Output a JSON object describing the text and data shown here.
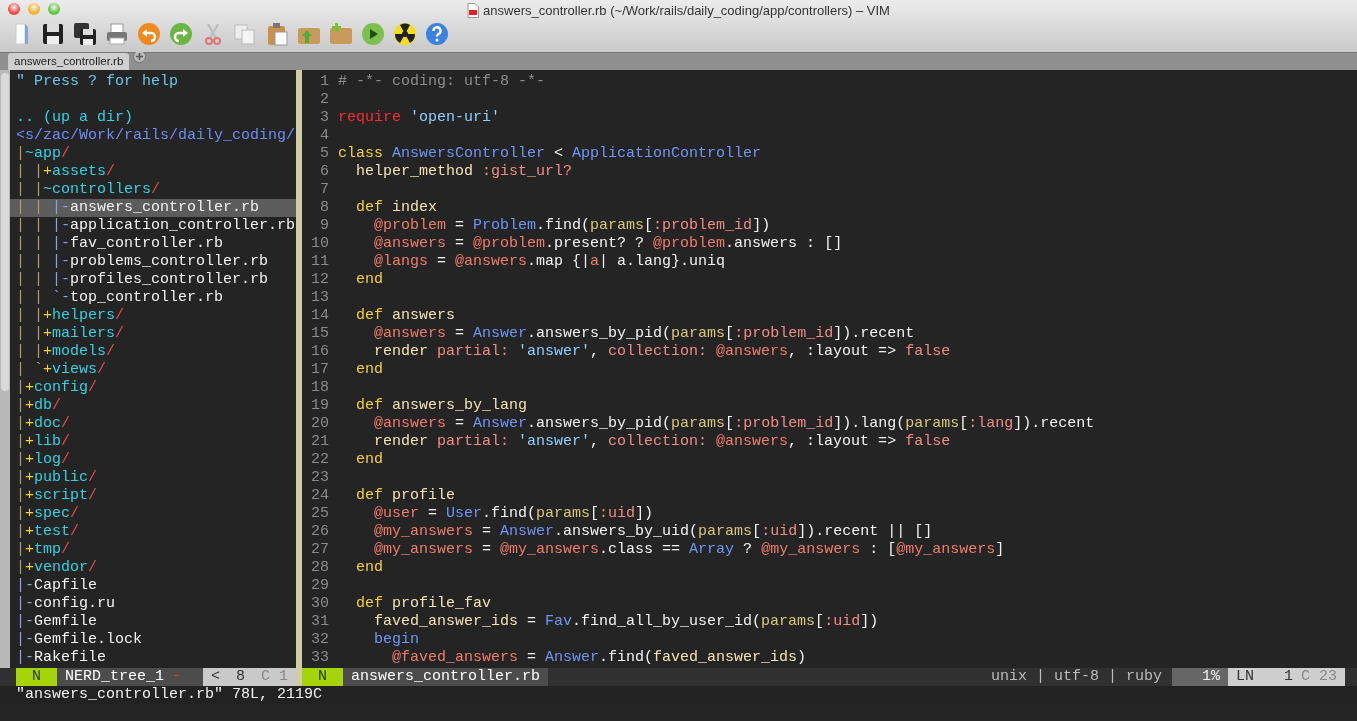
{
  "window": {
    "title": "answers_controller.rb (~/Work/rails/daily_coding/app/controllers) – VIM"
  },
  "tabs": [
    {
      "label": "answers_controller.rb",
      "selected": true
    }
  ],
  "nerd_tree": {
    "help": "\" Press ? for help",
    "up": ".. (up a dir)",
    "root": "<s/zac/Work/rails/daily_coding/",
    "items": [
      {
        "kind": "dir",
        "branch": "|",
        "marker": "~",
        "name": "app",
        "suffix": "/",
        "expanded": true,
        "selected": false,
        "children": [
          {
            "kind": "dir",
            "guides": "| ",
            "branch": "|",
            "marker": "+",
            "name": "assets",
            "suffix": "/",
            "expanded": false,
            "selected": false
          },
          {
            "kind": "dir",
            "guides": "| ",
            "branch": "|",
            "marker": "~",
            "name": "controllers",
            "suffix": "/",
            "expanded": true,
            "selected": false,
            "children": [
              {
                "kind": "file",
                "guides": "| | ",
                "branch": "|",
                "marker": "-",
                "name": "answers_controller.rb",
                "selected": true
              },
              {
                "kind": "file",
                "guides": "| | ",
                "branch": "|",
                "marker": "-",
                "name": "application_controller.rb",
                "selected": false
              },
              {
                "kind": "file",
                "guides": "| | ",
                "branch": "|",
                "marker": "-",
                "name": "fav_controller.rb",
                "selected": false
              },
              {
                "kind": "file",
                "guides": "| | ",
                "branch": "|",
                "marker": "-",
                "name": "problems_controller.rb",
                "selected": false
              },
              {
                "kind": "file",
                "guides": "| | ",
                "branch": "|",
                "marker": "-",
                "name": "profiles_controller.rb",
                "selected": false
              },
              {
                "kind": "file",
                "guides": "| | ",
                "branch": "`",
                "marker": "-",
                "name": "top_controller.rb",
                "selected": false
              }
            ]
          },
          {
            "kind": "dir",
            "guides": "| ",
            "branch": "|",
            "marker": "+",
            "name": "helpers",
            "suffix": "/",
            "expanded": false,
            "selected": false
          },
          {
            "kind": "dir",
            "guides": "| ",
            "branch": "|",
            "marker": "+",
            "name": "mailers",
            "suffix": "/",
            "expanded": false,
            "selected": false
          },
          {
            "kind": "dir",
            "guides": "| ",
            "branch": "|",
            "marker": "+",
            "name": "models",
            "suffix": "/",
            "expanded": false,
            "selected": false
          },
          {
            "kind": "dir",
            "guides": "| ",
            "branch": "`",
            "marker": "+",
            "name": "views",
            "suffix": "/",
            "expanded": false,
            "selected": false
          }
        ]
      },
      {
        "kind": "dir",
        "branch": "|",
        "marker": "+",
        "name": "config",
        "suffix": "/",
        "expanded": false,
        "selected": false
      },
      {
        "kind": "dir",
        "branch": "|",
        "marker": "+",
        "name": "db",
        "suffix": "/",
        "expanded": false,
        "selected": false
      },
      {
        "kind": "dir",
        "branch": "|",
        "marker": "+",
        "name": "doc",
        "suffix": "/",
        "expanded": false,
        "selected": false
      },
      {
        "kind": "dir",
        "branch": "|",
        "marker": "+",
        "name": "lib",
        "suffix": "/",
        "expanded": false,
        "selected": false
      },
      {
        "kind": "dir",
        "branch": "|",
        "marker": "+",
        "name": "log",
        "suffix": "/",
        "expanded": false,
        "selected": false
      },
      {
        "kind": "dir",
        "branch": "|",
        "marker": "+",
        "name": "public",
        "suffix": "/",
        "expanded": false,
        "selected": false
      },
      {
        "kind": "dir",
        "branch": "|",
        "marker": "+",
        "name": "script",
        "suffix": "/",
        "expanded": false,
        "selected": false
      },
      {
        "kind": "dir",
        "branch": "|",
        "marker": "+",
        "name": "spec",
        "suffix": "/",
        "expanded": false,
        "selected": false
      },
      {
        "kind": "dir",
        "branch": "|",
        "marker": "+",
        "name": "test",
        "suffix": "/",
        "expanded": false,
        "selected": false
      },
      {
        "kind": "dir",
        "branch": "|",
        "marker": "+",
        "name": "tmp",
        "suffix": "/",
        "expanded": false,
        "selected": false
      },
      {
        "kind": "dir",
        "branch": "|",
        "marker": "+",
        "name": "vendor",
        "suffix": "/",
        "expanded": false,
        "selected": false
      },
      {
        "kind": "file",
        "branch": "|",
        "marker": "-",
        "name": "Capfile",
        "selected": false
      },
      {
        "kind": "file",
        "branch": "|",
        "marker": "-",
        "name": "config.ru",
        "selected": false
      },
      {
        "kind": "file",
        "branch": "|",
        "marker": "-",
        "name": "Gemfile",
        "selected": false
      },
      {
        "kind": "file",
        "branch": "|",
        "marker": "-",
        "name": "Gemfile.lock",
        "selected": false
      },
      {
        "kind": "file",
        "branch": "|",
        "marker": "-",
        "name": "Rakefile",
        "selected": false
      }
    ]
  },
  "editor": {
    "lines": [
      {
        "number": "1",
        "tokens": [
          {
            "kind": "comment",
            "text": "# -*- coding: utf-8 -*-"
          }
        ]
      },
      {
        "number": "2"
      },
      {
        "number": "3",
        "tokens": [
          {
            "kind": "require",
            "text": "require"
          },
          {
            "kind": "string",
            "text": " 'open-uri'"
          }
        ]
      },
      {
        "number": "4"
      },
      {
        "number": "5",
        "tokens": [
          {
            "kind": "keyword",
            "text": "class"
          },
          {
            "kind": "const",
            "text": " AnswersController"
          },
          {
            "kind": "plain",
            "text": " < "
          },
          {
            "kind": "const",
            "text": "ApplicationController"
          }
        ]
      },
      {
        "number": "6",
        "tokens": [
          {
            "kind": "name",
            "text": "  helper_method"
          },
          {
            "kind": "symbol",
            "text": " :gist_url?"
          }
        ]
      },
      {
        "number": "7"
      },
      {
        "number": "8",
        "tokens": [
          {
            "kind": "keyword",
            "text": "  def"
          },
          {
            "kind": "name",
            "text": " index"
          }
        ]
      },
      {
        "number": "9",
        "tokens": [
          {
            "kind": "ivar",
            "text": "    @problem"
          },
          {
            "kind": "plain",
            "text": " = "
          },
          {
            "kind": "const",
            "text": "Problem"
          },
          {
            "kind": "plain",
            "text": ".find("
          },
          {
            "kind": "params",
            "text": "params"
          },
          {
            "kind": "plain",
            "text": "["
          },
          {
            "kind": "symbol",
            "text": ":problem_id"
          },
          {
            "kind": "plain",
            "text": "])"
          }
        ]
      },
      {
        "number": "10",
        "tokens": [
          {
            "kind": "ivar",
            "text": "    @answers"
          },
          {
            "kind": "plain",
            "text": " = "
          },
          {
            "kind": "ivar",
            "text": "@problem"
          },
          {
            "kind": "plain",
            "text": ".present? ? "
          },
          {
            "kind": "ivar",
            "text": "@problem"
          },
          {
            "kind": "plain",
            "text": ".answers : []"
          }
        ]
      },
      {
        "number": "11",
        "tokens": [
          {
            "kind": "ivar",
            "text": "    @langs"
          },
          {
            "kind": "plain",
            "text": " = "
          },
          {
            "kind": "ivar",
            "text": "@answers"
          },
          {
            "kind": "plain",
            "text": ".map {|"
          },
          {
            "kind": "ivar",
            "text": "a"
          },
          {
            "kind": "plain",
            "text": "| a.lang}.uniq"
          }
        ]
      },
      {
        "number": "12",
        "tokens": [
          {
            "kind": "keyword",
            "text": "  end"
          }
        ]
      },
      {
        "number": "13"
      },
      {
        "number": "14",
        "tokens": [
          {
            "kind": "keyword",
            "text": "  def"
          },
          {
            "kind": "name",
            "text": " answers"
          }
        ]
      },
      {
        "number": "15",
        "tokens": [
          {
            "kind": "ivar",
            "text": "    @answers"
          },
          {
            "kind": "plain",
            "text": " = "
          },
          {
            "kind": "const",
            "text": "Answer"
          },
          {
            "kind": "plain",
            "text": ".answers_by_pid("
          },
          {
            "kind": "params",
            "text": "params"
          },
          {
            "kind": "plain",
            "text": "["
          },
          {
            "kind": "symbol",
            "text": ":problem_id"
          },
          {
            "kind": "plain",
            "text": "]).recent"
          }
        ]
      },
      {
        "number": "16",
        "tokens": [
          {
            "kind": "name",
            "text": "    render"
          },
          {
            "kind": "symbol",
            "text": " partial:"
          },
          {
            "kind": "string",
            "text": " 'answer'"
          },
          {
            "kind": "plain",
            "text": ", "
          },
          {
            "kind": "symbol",
            "text": "collection:"
          },
          {
            "kind": "ivar",
            "text": " @answers"
          },
          {
            "kind": "plain",
            "text": ", :layout => "
          },
          {
            "kind": "symbol",
            "text": "false"
          }
        ]
      },
      {
        "number": "17",
        "tokens": [
          {
            "kind": "keyword",
            "text": "  end"
          }
        ]
      },
      {
        "number": "18"
      },
      {
        "number": "19",
        "tokens": [
          {
            "kind": "keyword",
            "text": "  def"
          },
          {
            "kind": "name",
            "text": " answers_by_lang"
          }
        ]
      },
      {
        "number": "20",
        "tokens": [
          {
            "kind": "ivar",
            "text": "    @answers"
          },
          {
            "kind": "plain",
            "text": " = "
          },
          {
            "kind": "const",
            "text": "Answer"
          },
          {
            "kind": "plain",
            "text": ".answers_by_pid("
          },
          {
            "kind": "params",
            "text": "params"
          },
          {
            "kind": "plain",
            "text": "["
          },
          {
            "kind": "symbol",
            "text": ":problem_id"
          },
          {
            "kind": "plain",
            "text": "]).lang("
          },
          {
            "kind": "params",
            "text": "params"
          },
          {
            "kind": "plain",
            "text": "["
          },
          {
            "kind": "symbol",
            "text": ":lang"
          },
          {
            "kind": "plain",
            "text": "]).recent"
          }
        ]
      },
      {
        "number": "21",
        "tokens": [
          {
            "kind": "name",
            "text": "    render"
          },
          {
            "kind": "symbol",
            "text": " partial:"
          },
          {
            "kind": "string",
            "text": " 'answer'"
          },
          {
            "kind": "plain",
            "text": ", "
          },
          {
            "kind": "symbol",
            "text": "collection:"
          },
          {
            "kind": "ivar",
            "text": " @answers"
          },
          {
            "kind": "plain",
            "text": ", :layout => "
          },
          {
            "kind": "symbol",
            "text": "false"
          }
        ]
      },
      {
        "number": "22",
        "tokens": [
          {
            "kind": "keyword",
            "text": "  end"
          }
        ]
      },
      {
        "number": "23"
      },
      {
        "number": "24",
        "tokens": [
          {
            "kind": "keyword",
            "text": "  def"
          },
          {
            "kind": "name",
            "text": " profile"
          }
        ]
      },
      {
        "number": "25",
        "tokens": [
          {
            "kind": "ivar",
            "text": "    @user"
          },
          {
            "kind": "plain",
            "text": " = "
          },
          {
            "kind": "const",
            "text": "User"
          },
          {
            "kind": "plain",
            "text": ".find("
          },
          {
            "kind": "params",
            "text": "params"
          },
          {
            "kind": "plain",
            "text": "["
          },
          {
            "kind": "symbol",
            "text": ":uid"
          },
          {
            "kind": "plain",
            "text": "])"
          }
        ]
      },
      {
        "number": "26",
        "tokens": [
          {
            "kind": "ivar",
            "text": "    @my_answers"
          },
          {
            "kind": "plain",
            "text": " = "
          },
          {
            "kind": "const",
            "text": "Answer"
          },
          {
            "kind": "plain",
            "text": ".answers_by_uid("
          },
          {
            "kind": "params",
            "text": "params"
          },
          {
            "kind": "plain",
            "text": "["
          },
          {
            "kind": "symbol",
            "text": ":uid"
          },
          {
            "kind": "plain",
            "text": "]).recent || []"
          }
        ]
      },
      {
        "number": "27",
        "tokens": [
          {
            "kind": "ivar",
            "text": "    @my_answers"
          },
          {
            "kind": "plain",
            "text": " = "
          },
          {
            "kind": "ivar",
            "text": "@my_answers"
          },
          {
            "kind": "plain",
            "text": ".class == "
          },
          {
            "kind": "const",
            "text": "Array"
          },
          {
            "kind": "plain",
            "text": " ? "
          },
          {
            "kind": "ivar",
            "text": "@my_answers"
          },
          {
            "kind": "plain",
            "text": " : ["
          },
          {
            "kind": "ivar",
            "text": "@my_answers"
          },
          {
            "kind": "plain",
            "text": "]"
          }
        ]
      },
      {
        "number": "28",
        "tokens": [
          {
            "kind": "keyword",
            "text": "  end"
          }
        ]
      },
      {
        "number": "29"
      },
      {
        "number": "30",
        "tokens": [
          {
            "kind": "keyword",
            "text": "  def"
          },
          {
            "kind": "name",
            "text": " profile_fav"
          }
        ]
      },
      {
        "number": "31",
        "tokens": [
          {
            "kind": "name",
            "text": "    faved_answer_ids"
          },
          {
            "kind": "plain",
            "text": " = "
          },
          {
            "kind": "const",
            "text": "Fav"
          },
          {
            "kind": "plain",
            "text": ".find_all_by_user_id("
          },
          {
            "kind": "params",
            "text": "params"
          },
          {
            "kind": "plain",
            "text": "["
          },
          {
            "kind": "symbol",
            "text": ":uid"
          },
          {
            "kind": "plain",
            "text": "])"
          }
        ]
      },
      {
        "number": "32",
        "tokens": [
          {
            "kind": "const",
            "text": "    begin"
          }
        ]
      },
      {
        "number": "33",
        "tokens": [
          {
            "kind": "ivar",
            "text": "      @faved_answers"
          },
          {
            "kind": "plain",
            "text": " = "
          },
          {
            "kind": "const",
            "text": "Answer"
          },
          {
            "kind": "plain",
            "text": ".find("
          },
          {
            "kind": "name",
            "text": "faved_answer_ids"
          },
          {
            "kind": "plain",
            "text": ")"
          }
        ]
      }
    ]
  },
  "status_left": {
    "mode": "N",
    "name": "NERD_tree_1",
    "modified": "-",
    "nav": "<",
    "line": "8",
    "column": "C 1"
  },
  "status_right": {
    "mode": "N",
    "file": "answers_controller.rb",
    "file_info": "unix | utf-8 | ruby",
    "percent": "1%",
    "ln_label": "LN",
    "line": "1",
    "column": "C 23"
  },
  "command_line": "\"answers_controller.rb\" 78L, 2119C"
}
